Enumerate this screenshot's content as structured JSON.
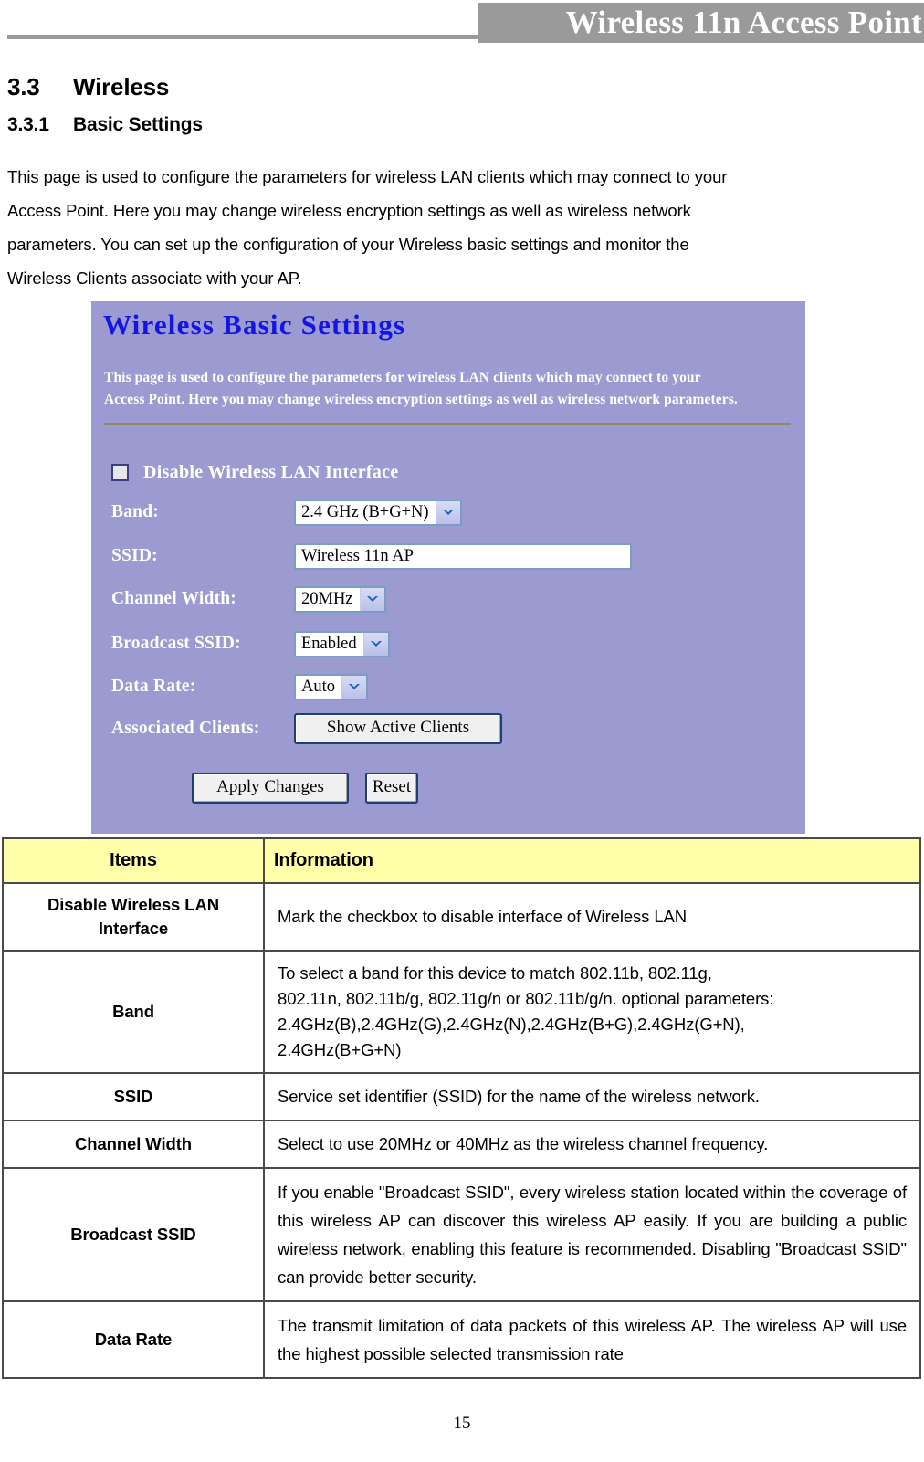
{
  "header": {
    "title": "Wireless 11n Access Point"
  },
  "section": {
    "h2_number": "3.3",
    "h2_title": "Wireless",
    "h3_number": "3.3.1",
    "h3_title": "Basic Settings",
    "intro_line1": "This page is used to configure the parameters for wireless LAN clients which may connect to your",
    "intro_line2": "Access Point. Here you may change wireless encryption settings as well as wireless network",
    "intro_line3": "parameters. You can set up the configuration of your Wireless basic settings and monitor the",
    "intro_line4": "Wireless Clients associate with your AP."
  },
  "screenshot": {
    "title": "Wireless Basic Settings",
    "description_line1": "This page is used to configure the parameters for wireless LAN clients which may connect to your",
    "description_line2": "Access Point. Here you may change wireless encryption settings as well as wireless network parameters.",
    "disable_checkbox_label": "Disable Wireless LAN Interface",
    "disable_checkbox_checked": false,
    "fields": {
      "band_label": "Band:",
      "band_value": "2.4 GHz (B+G+N)",
      "ssid_label": "SSID:",
      "ssid_value": "Wireless 11n AP",
      "channel_width_label": "Channel Width:",
      "channel_width_value": "20MHz",
      "broadcast_ssid_label": "Broadcast SSID:",
      "broadcast_ssid_value": "Enabled",
      "data_rate_label": "Data Rate:",
      "data_rate_value": "Auto",
      "associated_clients_label": "Associated Clients:",
      "show_active_clients_button": "Show Active Clients"
    },
    "buttons": {
      "apply": "Apply Changes",
      "reset": "Reset"
    },
    "colors": {
      "panel_background": "#9b9bd1",
      "title_text": "#1414e6",
      "separator": "#8d8d5e"
    }
  },
  "table": {
    "headers": {
      "items": "Items",
      "information": "Information"
    },
    "header_background": "#ffffaa",
    "rows": [
      {
        "item": "Disable Wireless LAN Interface",
        "information": "Mark the checkbox to disable interface of Wireless LAN"
      },
      {
        "item": "Band",
        "information": "To select a band for this device to match 802.11b, 802.11g,\n802.11n, 802.11b/g, 802.11g/n or 802.11b/g/n. optional parameters:\n2.4GHz(B),2.4GHz(G),2.4GHz(N),2.4GHz(B+G),2.4GHz(G+N),\n2.4GHz(B+G+N)"
      },
      {
        "item": "SSID",
        "information": "Service set identifier (SSID) for the name of the wireless network."
      },
      {
        "item": "Channel Width",
        "information": "Select to use 20MHz or 40MHz as the wireless channel frequency."
      },
      {
        "item": "Broadcast SSID",
        "information": "If you enable \"Broadcast SSID\", every wireless station located within the coverage of this wireless AP can discover this wireless AP easily. If you are building a public wireless network, enabling this feature is recommended. Disabling \"Broadcast SSID\" can provide better security."
      },
      {
        "item": "Data Rate",
        "information": "The transmit limitation of data packets of this wireless AP. The wireless AP will use the highest possible selected transmission rate"
      }
    ]
  },
  "footer": {
    "page_number": "15"
  }
}
